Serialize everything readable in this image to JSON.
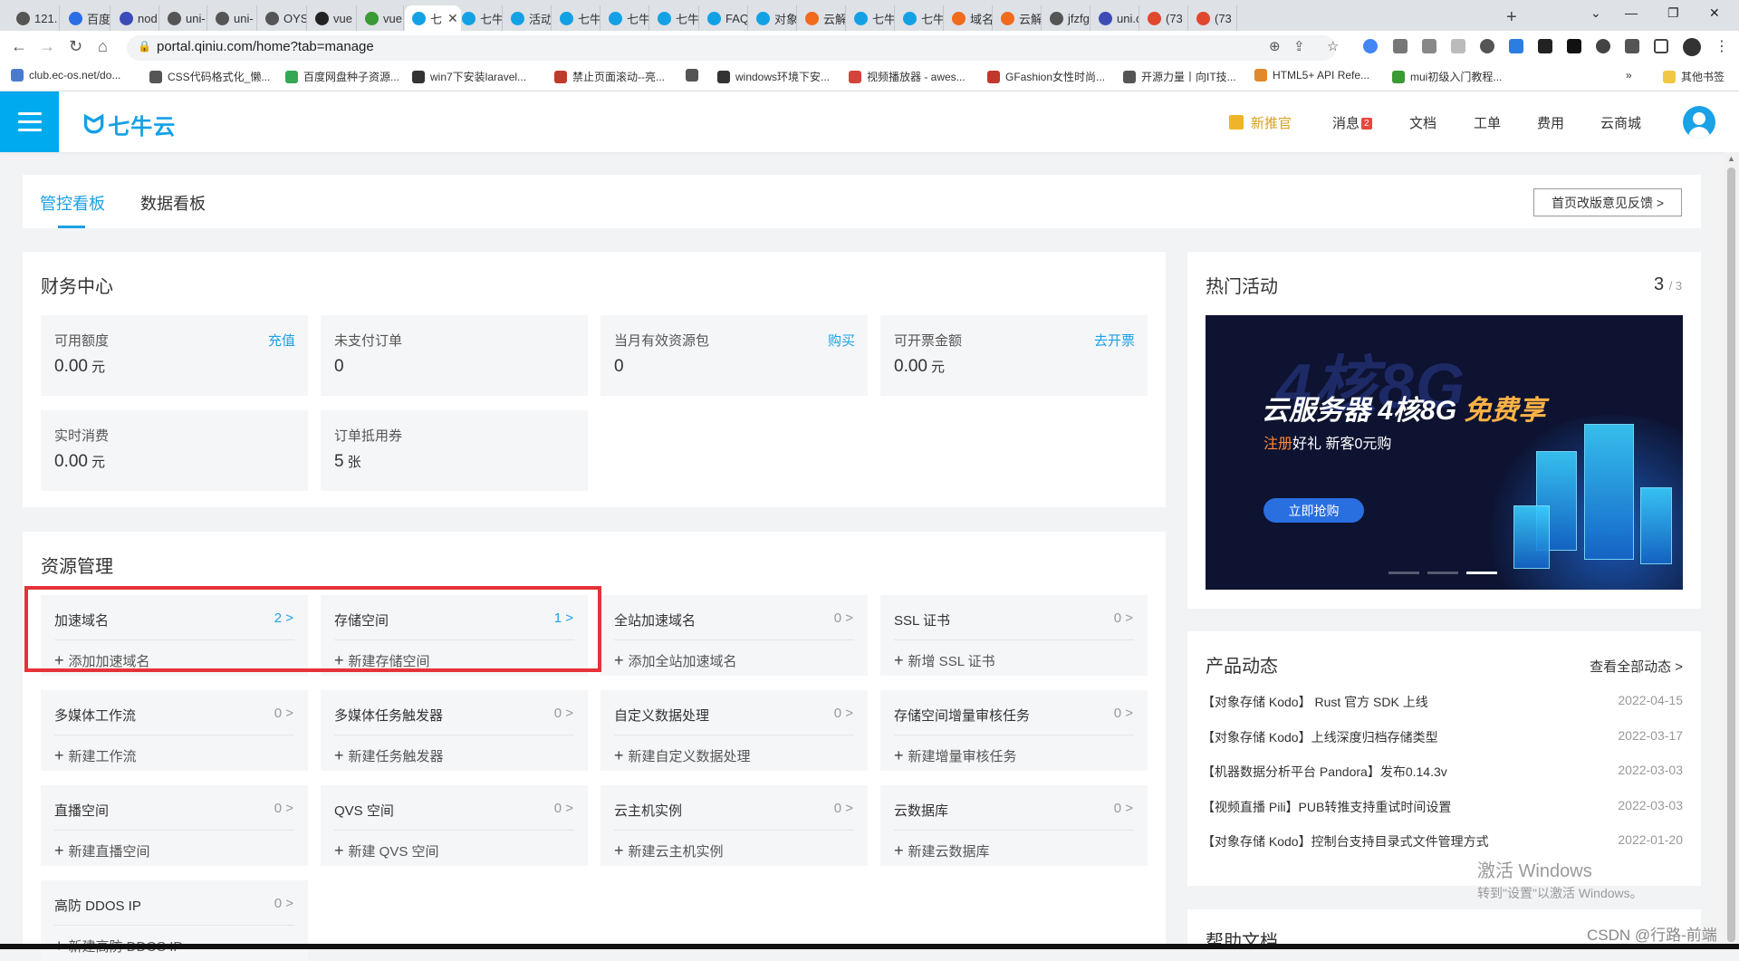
{
  "browser": {
    "tabs": [
      {
        "label": "121.",
        "color": "#555"
      },
      {
        "label": "百度",
        "color": "#2b6de5"
      },
      {
        "label": "nod",
        "color": "#3d4bb8"
      },
      {
        "label": "uni-",
        "color": "#555"
      },
      {
        "label": "uni-",
        "color": "#555"
      },
      {
        "label": "OYS",
        "color": "#555"
      },
      {
        "label": "vue",
        "color": "#222"
      },
      {
        "label": "vue",
        "color": "#3a9a34"
      },
      {
        "label": "七",
        "color": "#13a1e6"
      },
      {
        "label": "七牛",
        "color": "#13a1e6"
      },
      {
        "label": "活动",
        "color": "#13a1e6"
      },
      {
        "label": "七牛",
        "color": "#13a1e6"
      },
      {
        "label": "七牛",
        "color": "#13a1e6"
      },
      {
        "label": "七牛",
        "color": "#13a1e6"
      },
      {
        "label": "FAQ",
        "color": "#13a1e6"
      },
      {
        "label": "对象",
        "color": "#13a1e6"
      },
      {
        "label": "云解",
        "color": "#f06b1c"
      },
      {
        "label": "七牛",
        "color": "#13a1e6"
      },
      {
        "label": "七牛",
        "color": "#13a1e6"
      },
      {
        "label": "域名",
        "color": "#f06b1c"
      },
      {
        "label": "云解",
        "color": "#f06b1c"
      },
      {
        "label": "jfzfg",
        "color": "#555"
      },
      {
        "label": "uni.c",
        "color": "#3d4bb8"
      },
      {
        "label": "(73",
        "color": "#e0472f"
      },
      {
        "label": "(73",
        "color": "#e0472f"
      }
    ],
    "active_tab_index": 8,
    "new_tab_label": "+",
    "url": "portal.qiniu.com/home?tab=manage",
    "bookmarks": [
      {
        "label": "club.ec-os.net/do...",
        "color": "#4a7bd0"
      },
      {
        "label": "CSS代码格式化_懒...",
        "color": "#555"
      },
      {
        "label": "百度网盘种子资源...",
        "color": "#34a853"
      },
      {
        "label": "win7下安装laravel...",
        "color": "#333"
      },
      {
        "label": "禁止页面滚动--亮...",
        "color": "#c0392b"
      },
      {
        "label": "",
        "color": "#555"
      },
      {
        "label": "windows环境下安...",
        "color": "#333"
      },
      {
        "label": "视频播放器 - awes...",
        "color": "#d1453b"
      },
      {
        "label": "GFashion女性时尚...",
        "color": "#c0392b"
      },
      {
        "label": "开源力量丨向IT技...",
        "color": "#555"
      },
      {
        "label": "HTML5+ API Refe...",
        "color": "#e08a2b"
      },
      {
        "label": "mui初级入门教程...",
        "color": "#3a9a34"
      }
    ],
    "bookmarks_more": "»",
    "other_bookmarks": "其他书签"
  },
  "header": {
    "brand": "七牛云",
    "nav": [
      {
        "label": "新推官",
        "accent": true
      },
      {
        "label": "消息",
        "badge": "2"
      },
      {
        "label": "文档"
      },
      {
        "label": "工单"
      },
      {
        "label": "费用"
      },
      {
        "label": "云商城"
      }
    ]
  },
  "page_tabs": {
    "items": [
      "管控看板",
      "数据看板"
    ],
    "active": 0,
    "feedback": "首页改版意见反馈 >"
  },
  "finance": {
    "title": "财务中心",
    "items": [
      {
        "label": "可用额度",
        "link": "充值",
        "value": "0.00",
        "unit": "元"
      },
      {
        "label": "未支付订单",
        "link": "",
        "value": "0",
        "unit": ""
      },
      {
        "label": "当月有效资源包",
        "link": "购买",
        "value": "0",
        "unit": ""
      },
      {
        "label": "可开票金额",
        "link": "去开票",
        "value": "0.00",
        "unit": "元"
      },
      {
        "label": "实时消费",
        "link": "",
        "value": "0.00",
        "unit": "元"
      },
      {
        "label": "订单抵用券",
        "link": "",
        "value": "5",
        "unit": "张"
      }
    ]
  },
  "resources": {
    "title": "资源管理",
    "items": [
      {
        "title": "加速域名",
        "count": "2 >",
        "active": true,
        "add": "添加加速域名"
      },
      {
        "title": "存储空间",
        "count": "1 >",
        "active": true,
        "add": "新建存储空间"
      },
      {
        "title": "全站加速域名",
        "count": "0 >",
        "active": false,
        "add": "添加全站加速域名"
      },
      {
        "title": "SSL 证书",
        "count": "0 >",
        "active": false,
        "add": "新增 SSL 证书"
      },
      {
        "title": "多媒体工作流",
        "count": "0 >",
        "active": false,
        "add": "新建工作流"
      },
      {
        "title": "多媒体任务触发器",
        "count": "0 >",
        "active": false,
        "add": "新建任务触发器"
      },
      {
        "title": "自定义数据处理",
        "count": "0 >",
        "active": false,
        "add": "新建自定义数据处理"
      },
      {
        "title": "存储空间增量审核任务",
        "count": "0 >",
        "active": false,
        "add": "新建增量审核任务"
      },
      {
        "title": "直播空间",
        "count": "0 >",
        "active": false,
        "add": "新建直播空间"
      },
      {
        "title": "QVS 空间",
        "count": "0 >",
        "active": false,
        "add": "新建 QVS 空间"
      },
      {
        "title": "云主机实例",
        "count": "0 >",
        "active": false,
        "add": "新建云主机实例"
      },
      {
        "title": "云数据库",
        "count": "0 >",
        "active": false,
        "add": "新建云数据库"
      },
      {
        "title": "高防 DDOS IP",
        "count": "0 >",
        "active": false,
        "add": "新建高防 DDOS IP"
      }
    ]
  },
  "hot": {
    "title": "热门活动",
    "current": "3",
    "total": "/ 3",
    "banner": {
      "bg_text": "4核8G",
      "title_main": "云服务器 4核8G ",
      "title_accent": "免费享",
      "sub_accent": "注册",
      "sub_rest": "好礼  新客0元购",
      "cta": "立即抢购"
    }
  },
  "news": {
    "title": "产品动态",
    "all": "查看全部动态 >",
    "items": [
      {
        "title": "【对象存储 Kodo】 Rust 官方 SDK 上线",
        "date": "2022-04-15"
      },
      {
        "title": "【对象存储 Kodo】上线深度归档存储类型",
        "date": "2022-03-17"
      },
      {
        "title": "【机器数据分析平台 Pandora】发布0.14.3v",
        "date": "2022-03-03"
      },
      {
        "title": "【视频直播 Pili】PUB转推支持重试时间设置",
        "date": "2022-03-03"
      },
      {
        "title": "【对象存储 Kodo】控制台支持目录式文件管理方式",
        "date": "2022-01-20"
      }
    ]
  },
  "help": {
    "title": "帮助文档"
  },
  "watermark": {
    "line1": "激活 Windows",
    "line2": "转到\"设置\"以激活 Windows。"
  },
  "csdn": "CSDN @行路-前端"
}
